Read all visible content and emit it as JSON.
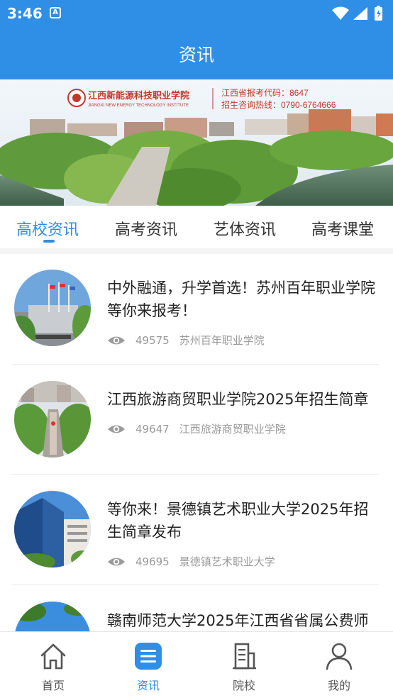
{
  "status_bar": {
    "time": "3:46"
  },
  "header": {
    "title": "资讯"
  },
  "banner": {
    "school_name_cn": "江西新能源科技职业学院",
    "school_name_en": "JIANGXI NEW ENERGY TECHNOLOGY INSTITUTE",
    "code_line": "江西省报考代码：8647",
    "hotline_line": "招生咨询热线：0790-6764666"
  },
  "tabs": [
    {
      "label": "高校资讯",
      "active": true
    },
    {
      "label": "高考资讯",
      "active": false
    },
    {
      "label": "艺体资讯",
      "active": false
    },
    {
      "label": "高考课堂",
      "active": false
    }
  ],
  "news": [
    {
      "title": "中外融通，升学首选！苏州百年职业学院等你来报考！",
      "views": "49575",
      "source": "苏州百年职业学院"
    },
    {
      "title": "江西旅游商贸职业学院2025年招生简章",
      "views": "49647",
      "source": "江西旅游商贸职业学院"
    },
    {
      "title": "等你来！景德镇艺术职业大学2025年招生简章发布",
      "views": "49695",
      "source": "景德镇艺术职业大学"
    },
    {
      "title": "赣南师范大学2025年江西省省属公费师"
    }
  ],
  "bottom_nav": [
    {
      "label": "首页",
      "icon": "home-icon",
      "active": false
    },
    {
      "label": "资讯",
      "icon": "news-list-icon",
      "active": true
    },
    {
      "label": "院校",
      "icon": "building-icon",
      "active": false
    },
    {
      "label": "我的",
      "icon": "person-icon",
      "active": false
    }
  ],
  "colors": {
    "accent": "#2f8ee6",
    "muted_text": "#999999"
  }
}
